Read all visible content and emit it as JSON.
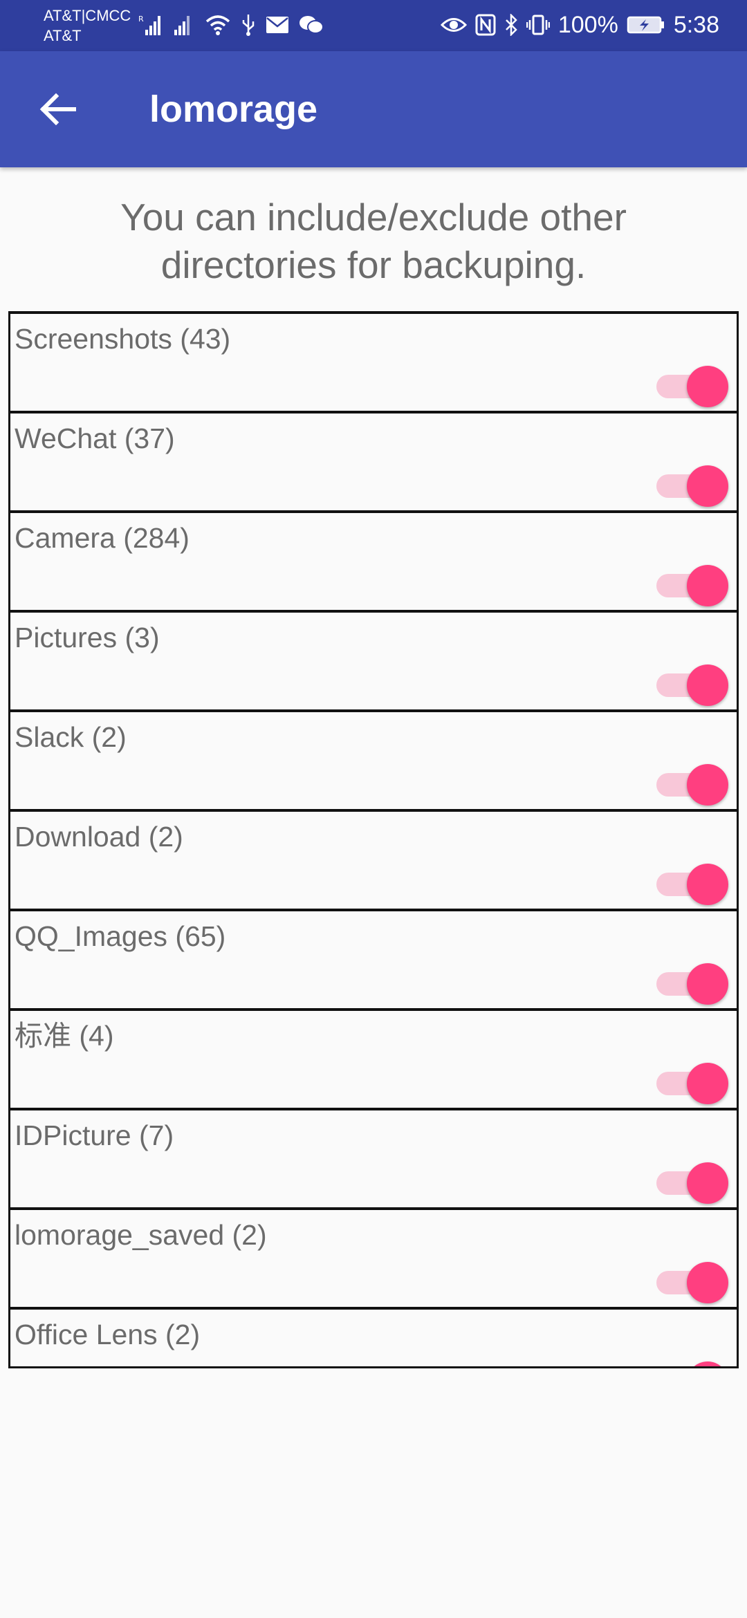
{
  "status_bar": {
    "carrier_line1": "AT&T|CMCC",
    "carrier_line2": "AT&T",
    "battery_percent": "100%",
    "time": "5:38"
  },
  "app_bar": {
    "title": "lomorage"
  },
  "description": {
    "line1": "You can include/exclude other",
    "line2": "directories for backuping."
  },
  "directories": [
    {
      "label": "Screenshots (43)",
      "enabled": true
    },
    {
      "label": "WeChat (37)",
      "enabled": true
    },
    {
      "label": "Camera (284)",
      "enabled": true
    },
    {
      "label": "Pictures (3)",
      "enabled": true
    },
    {
      "label": "Slack (2)",
      "enabled": true
    },
    {
      "label": "Download (2)",
      "enabled": true
    },
    {
      "label": "QQ_Images (65)",
      "enabled": true
    },
    {
      "label": "标准 (4)",
      "enabled": true
    },
    {
      "label": "IDPicture (7)",
      "enabled": true
    },
    {
      "label": "lomorage_saved (2)",
      "enabled": true
    },
    {
      "label": "Office Lens (2)",
      "enabled": true
    }
  ],
  "colors": {
    "status_bar": "#2f3e9e",
    "app_bar": "#3f51b5",
    "toggle_thumb": "#ff3f80",
    "toggle_track": "#f8c7d8"
  }
}
